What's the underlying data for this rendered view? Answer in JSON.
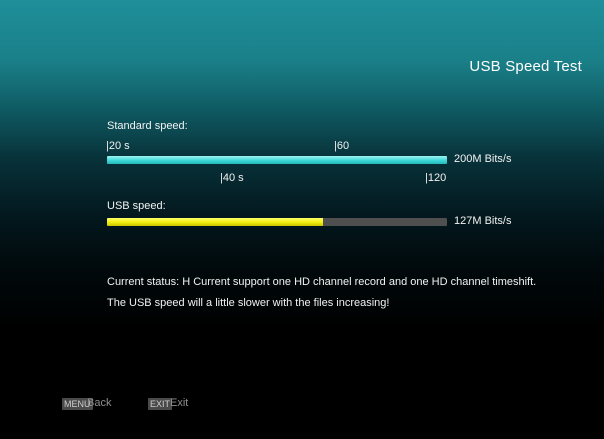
{
  "header": {
    "title": "USB Speed Test"
  },
  "standard": {
    "label": "Standard speed:",
    "marks_top": [
      "|20 s",
      "|60"
    ],
    "marks_bottom": [
      "|40 s",
      "|120"
    ],
    "speed": "200M Bits/s",
    "fill_fraction": 1.0,
    "color": "#3fd8d8"
  },
  "usb": {
    "label": "USB speed:",
    "speed": "127M Bits/s",
    "fill_fraction": 0.635,
    "color": "#f2ee10"
  },
  "status": {
    "line1": "Current status: H Current support one HD channel record and one HD channel timeshift.",
    "line2": "The USB speed will a little slower with the files increasing!"
  },
  "footer": {
    "menu_key": "MENU",
    "menu_label": "Back",
    "exit_key": "EXIT",
    "exit_label": "Exit"
  }
}
